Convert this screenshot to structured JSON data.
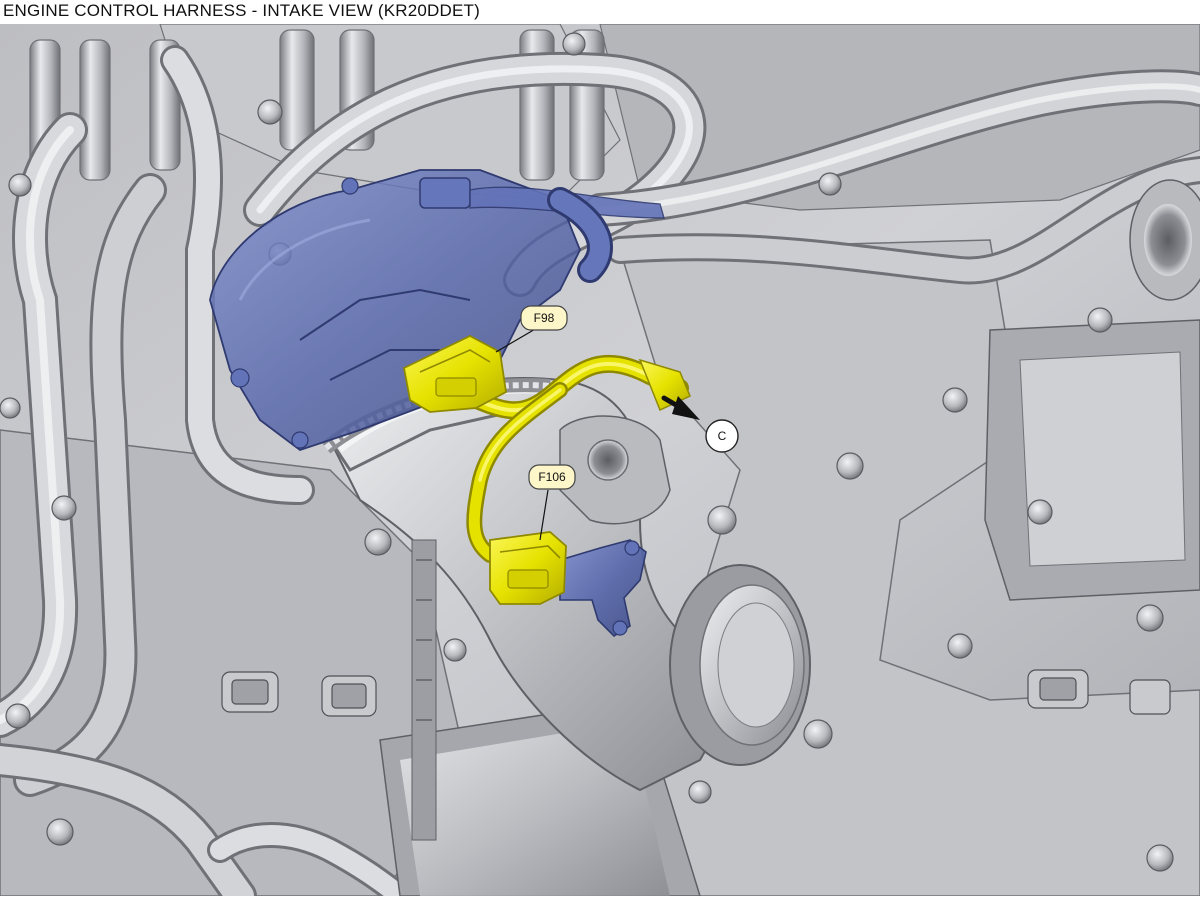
{
  "diagram": {
    "title": "ENGINE CONTROL HARNESS - INTAKE VIEW (KR20DDET)",
    "connectors": [
      {
        "id": "F98",
        "label": "F98"
      },
      {
        "id": "F106",
        "label": "F106"
      }
    ],
    "continuation": {
      "label": "C"
    },
    "colors": {
      "background": "#ffffff",
      "engine_metal_light": "#d3d4d8",
      "engine_metal_mid": "#a6a8ad",
      "engine_metal_dark": "#6f7176",
      "component_highlight": "#4f5fa0",
      "harness_yellow": "#e6e200",
      "harness_yellow_dark": "#9a9400",
      "label_fill": "#fdf6c8",
      "arrow": "#111111"
    }
  }
}
